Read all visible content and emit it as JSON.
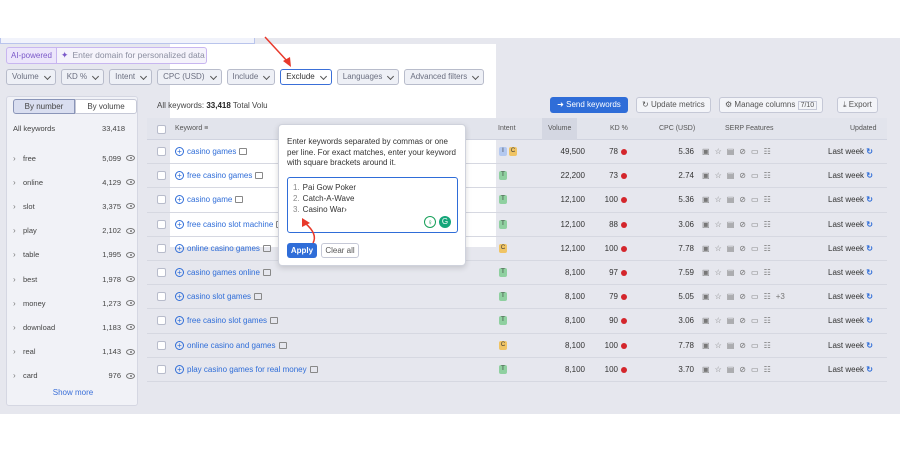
{
  "ai": {
    "badge": "AI-powered",
    "placeholder": "Enter domain for personalized data"
  },
  "filters": [
    "Volume",
    "KD %",
    "Intent",
    "CPC (USD)",
    "Include",
    "Exclude",
    "Languages",
    "Advanced filters"
  ],
  "view_toggle": {
    "by_number": "By number",
    "by_volume": "By volume"
  },
  "sidebar": {
    "header_label": "All keywords",
    "header_count": "33,418",
    "items": [
      {
        "word": "free",
        "count": "5,099"
      },
      {
        "word": "online",
        "count": "4,129"
      },
      {
        "word": "slot",
        "count": "3,375"
      },
      {
        "word": "play",
        "count": "2,102"
      },
      {
        "word": "table",
        "count": "1,995"
      },
      {
        "word": "best",
        "count": "1,978"
      },
      {
        "word": "money",
        "count": "1,273"
      },
      {
        "word": "download",
        "count": "1,183"
      },
      {
        "word": "real",
        "count": "1,143"
      },
      {
        "word": "card",
        "count": "976"
      }
    ],
    "show_more": "Show more"
  },
  "toolbar": {
    "all_keywords_label": "All keywords:",
    "all_keywords_count": "33,418",
    "total_volume_label": "Total Volu",
    "send_keywords": "Send keywords",
    "update_metrics": "Update metrics",
    "manage_columns": "Manage columns",
    "manage_columns_count": "7/10",
    "export": "Export"
  },
  "table": {
    "headers": {
      "keyword": "Keyword",
      "intent": "Intent",
      "volume": "Volume",
      "kd": "KD %",
      "cpc": "CPC (USD)",
      "serp": "SERP Features",
      "updated": "Updated"
    },
    "rows": [
      {
        "keyword": "casino games",
        "intent": [
          "I",
          "C"
        ],
        "volume": "49,500",
        "kd": "78",
        "cpc": "5.36",
        "extra": "",
        "updated": "Last week"
      },
      {
        "keyword": "free casino games",
        "intent": [
          "T"
        ],
        "volume": "22,200",
        "kd": "73",
        "cpc": "2.74",
        "extra": "",
        "updated": "Last week"
      },
      {
        "keyword": "casino game",
        "intent": [
          "T"
        ],
        "volume": "12,100",
        "kd": "100",
        "cpc": "5.36",
        "extra": "",
        "updated": "Last week"
      },
      {
        "keyword": "free casino slot machine",
        "intent": [
          "T"
        ],
        "volume": "12,100",
        "kd": "88",
        "cpc": "3.06",
        "extra": "",
        "updated": "Last week"
      },
      {
        "keyword": "online casino games",
        "intent": [
          "C"
        ],
        "volume": "12,100",
        "kd": "100",
        "cpc": "7.78",
        "extra": "",
        "updated": "Last week"
      },
      {
        "keyword": "casino games online",
        "intent": [
          "T"
        ],
        "volume": "8,100",
        "kd": "97",
        "cpc": "7.59",
        "extra": "",
        "updated": "Last week"
      },
      {
        "keyword": "casino slot games",
        "intent": [
          "T"
        ],
        "volume": "8,100",
        "kd": "79",
        "cpc": "5.05",
        "extra": "+3",
        "updated": "Last week"
      },
      {
        "keyword": "free casino slot games",
        "intent": [
          "T"
        ],
        "volume": "8,100",
        "kd": "90",
        "cpc": "3.06",
        "extra": "",
        "updated": "Last week"
      },
      {
        "keyword": "online casino and games",
        "intent": [
          "C"
        ],
        "volume": "8,100",
        "kd": "100",
        "cpc": "7.78",
        "extra": "",
        "updated": "Last week"
      },
      {
        "keyword": "play casino games for real money",
        "intent": [
          "T"
        ],
        "volume": "8,100",
        "kd": "100",
        "cpc": "3.70",
        "extra": "",
        "updated": "Last week"
      }
    ]
  },
  "exclude_popover": {
    "instructions": "Enter keywords separated by commas or one per line. For exact matches, enter your keyword with square brackets around it.",
    "lines": [
      "Pai Gow Poker",
      "Catch-A-Wave",
      "Casino War›"
    ],
    "apply": "Apply",
    "clear_all": "Clear all"
  },
  "colors": {
    "accent": "#2f6dd8",
    "annotation_arrow": "#e8392b",
    "kd_dot": "#d4262c",
    "overlay": "#e6e7ee"
  }
}
